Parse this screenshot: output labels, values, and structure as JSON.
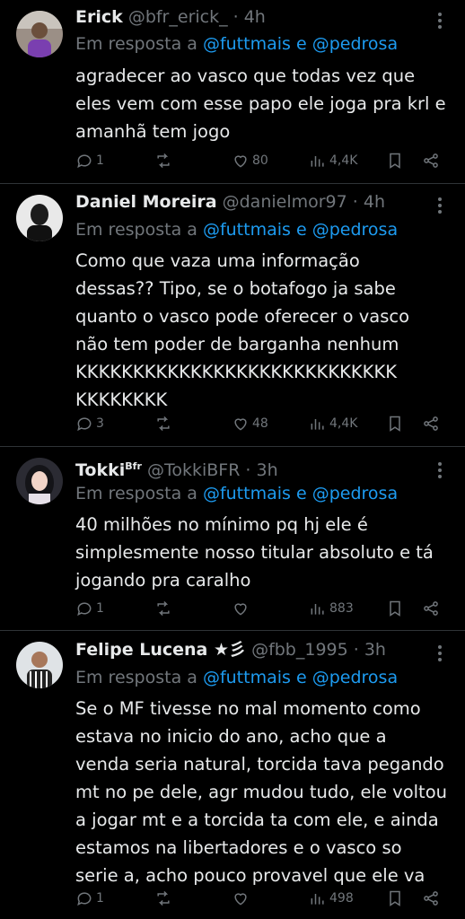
{
  "tweets": [
    {
      "name": "Erick",
      "handle": "@bfr_erick_ · 4h",
      "reply_prefix": "Em resposta a",
      "reply_to_1": "@futtmais",
      "reply_and": "e",
      "reply_to_2": "@pedrosa",
      "lines": [
        "agradecer ao vasco que todas vez que",
        "eles vem com esse papo ele joga pra krl e",
        "amanhã tem jogo"
      ],
      "replies": "1",
      "retweets": "",
      "likes": "80",
      "views": "4,4K"
    },
    {
      "name": "Daniel Moreira",
      "handle": "@danielmor97 · 4h",
      "reply_prefix": "Em resposta a",
      "reply_to_1": "@futtmais",
      "reply_and": "e",
      "reply_to_2": "@pedrosa",
      "lines": [
        "Como que vaza uma informação",
        "dessas?? Tipo, se o botafogo ja sabe",
        "quanto o vasco pode oferecer o vasco",
        "não tem poder de barganha nenhum",
        "KKKKKKKKKKKKKKKKKKKKKKKKKKKK",
        "KKKKKKKK"
      ],
      "replies": "3",
      "retweets": "",
      "likes": "48",
      "views": "4,4K"
    },
    {
      "name": "Tokki",
      "name_sup": "Bfr",
      "handle": "@TokkiBFR · 3h",
      "reply_prefix": "Em resposta a",
      "reply_to_1": "@futtmais",
      "reply_and": "e",
      "reply_to_2": "@pedrosa",
      "lines": [
        "40 milhões no mínimo pq hj ele é",
        "simplesmente nosso titular absoluto e tá",
        "jogando pra caralho"
      ],
      "replies": "1",
      "retweets": "",
      "likes": "",
      "views": "883"
    },
    {
      "name": "Felipe Lucena ★彡",
      "handle": "@fbb_1995 · 3h",
      "reply_prefix": "Em resposta a",
      "reply_to_1": "@futtmais",
      "reply_and": "e",
      "reply_to_2": "@pedrosa",
      "lines": [
        "Se o MF tivesse no mal momento como",
        "estava no inicio do ano, acho que a",
        "venda seria natural, torcida tava pegando",
        "mt no pe dele, agr mudou tudo, ele voltou",
        "a jogar mt e a torcida ta com ele, e ainda",
        "estamos na libertadores e o vasco so",
        "serie a, acho pouco provavel que ele va"
      ],
      "replies": "1",
      "retweets": "",
      "likes": "",
      "views": "498"
    }
  ],
  "colors": {
    "background": "#000000",
    "text": "#e7e9ea",
    "muted": "#71767b",
    "link": "#1d9bf0"
  }
}
